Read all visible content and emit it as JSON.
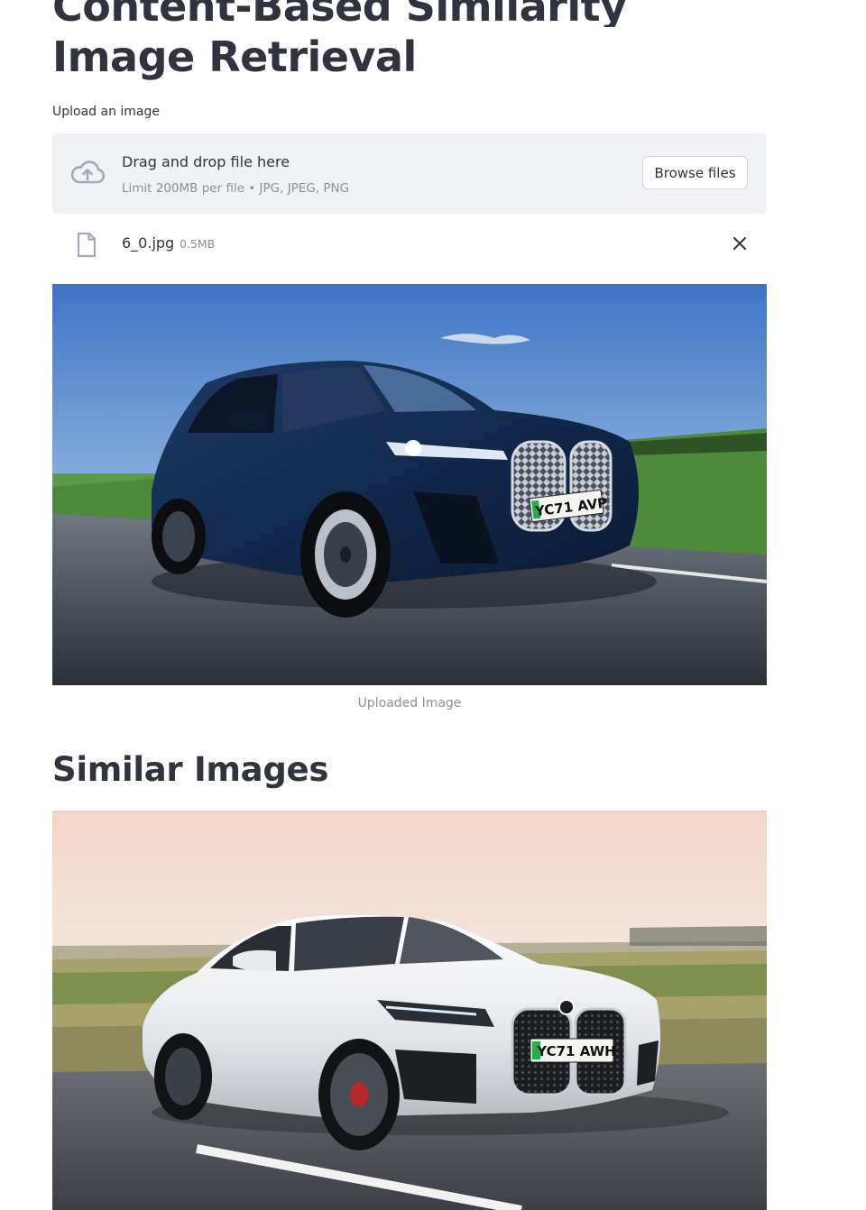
{
  "header": {
    "title_line1": "Content-Based Similarity",
    "title_line2": "Image Retrieval"
  },
  "uploader": {
    "label": "Upload an image",
    "drop_text": "Drag and drop file here",
    "limit_text": "Limit 200MB per file • JPG, JPEG, PNG",
    "browse_label": "Browse files",
    "icon": "cloud-upload-icon"
  },
  "uploaded_file": {
    "name": "6_0.jpg",
    "size": "0.5MB",
    "icon": "file-icon",
    "remove_icon": "close-icon"
  },
  "preview": {
    "caption": "Uploaded Image",
    "plate": "YC71 AVP"
  },
  "results": {
    "title": "Similar Images",
    "items": [
      {
        "plate": "YC71 AWH"
      }
    ]
  },
  "colors": {
    "text": "#31333f",
    "muted": "#8e9099",
    "dropzone_bg": "#f0f2f6",
    "icon": "#a3a8b8"
  }
}
